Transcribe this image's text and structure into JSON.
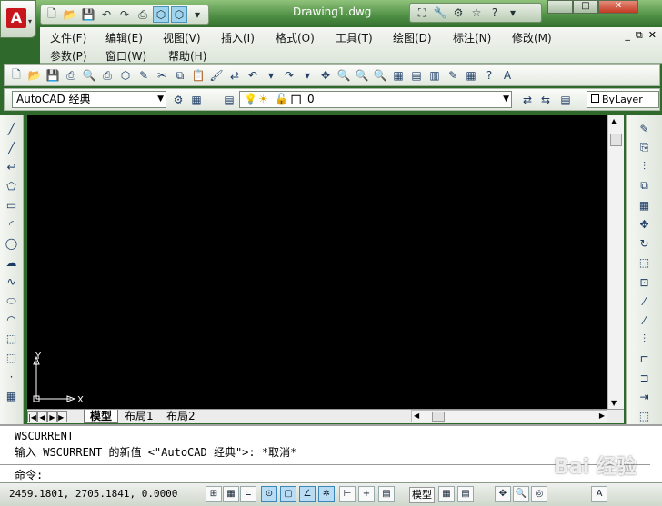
{
  "window": {
    "title": "Drawing1.dwg",
    "minimize": "─",
    "maximize": "□",
    "close": "✕"
  },
  "app_button": {
    "logo": "A",
    "arrow": "▾"
  },
  "quick_access": {
    "icons": [
      "new-icon",
      "open-icon",
      "save-icon",
      "undo-icon",
      "redo-icon",
      "plot-icon",
      "3d-box-icon",
      "3d-box-icon",
      "more-icon"
    ],
    "glyphs": [
      "🗋",
      "📂",
      "💾",
      "↶",
      "↷",
      "⎙",
      "⬡",
      "⬡",
      "▾"
    ]
  },
  "infocenter": {
    "glyphs": [
      "⛶",
      "🔧",
      "⚙",
      "☆",
      "?",
      "▾"
    ]
  },
  "menu": {
    "row1": [
      "文件(F)",
      "编辑(E)",
      "视图(V)",
      "插入(I)",
      "格式(O)",
      "工具(T)",
      "绘图(D)",
      "标注(N)",
      "修改(M)"
    ],
    "row2": [
      "参数(P)",
      "窗口(W)",
      "帮助(H)"
    ],
    "mdi": [
      "_",
      "⧉",
      "✕"
    ]
  },
  "toolbar_standard": {
    "glyphs": [
      "🗋",
      "📂",
      "💾",
      "⎙",
      "🔍",
      "⎙",
      "⬡",
      "✎",
      "✂",
      "⧉",
      "📋",
      "🖌",
      "⇄",
      "↶",
      "▾",
      "↷",
      "▾",
      "✥",
      "🔍",
      "🔍",
      "🔍",
      "▦",
      "▤",
      "▥",
      "✎",
      "▦",
      "?",
      "A"
    ]
  },
  "workspace": {
    "value": "AutoCAD 经典"
  },
  "layer": {
    "value": "0",
    "glyphs": [
      "💡",
      "☀",
      "🔓",
      "■"
    ]
  },
  "color_control": {
    "value": "ByLayer"
  },
  "draw_toolbar": {
    "glyphs": [
      "╱",
      "╱",
      "↩",
      "⬠",
      "▭",
      "◜",
      "◯",
      "☁",
      "∿",
      "⬭",
      "◠",
      "⬚",
      "⬚",
      "·",
      "▦"
    ]
  },
  "modify_toolbar": {
    "glyphs": [
      "✎",
      "⎘",
      "⫶",
      "⧉",
      "▦",
      "✥",
      "↻",
      "⬚",
      "⊡",
      "⁄",
      "⁄",
      "⫶",
      "⊏",
      "⊐",
      "⇥",
      "⬚"
    ]
  },
  "ucs": {
    "y": "Y",
    "x": "X"
  },
  "layout_tabs": {
    "nav": [
      "|◀",
      "◀",
      "▶",
      "▶|"
    ],
    "tabs": [
      "模型",
      "布局1",
      "布局2"
    ]
  },
  "command": {
    "history": [
      "WSCURRENT",
      "输入 WSCURRENT 的新值 <\"AutoCAD 经典\">: *取消*"
    ],
    "prompt": "命令:"
  },
  "status": {
    "coords": "2459.1801,  2705.1841, 0.0000",
    "model": "模型",
    "toggles": [
      "⊞",
      "▦",
      "∟",
      "⊙",
      "▢",
      "∠",
      "✲",
      "⊢",
      "+",
      "▤"
    ]
  },
  "watermark": {
    "text": "Bai 经验"
  }
}
